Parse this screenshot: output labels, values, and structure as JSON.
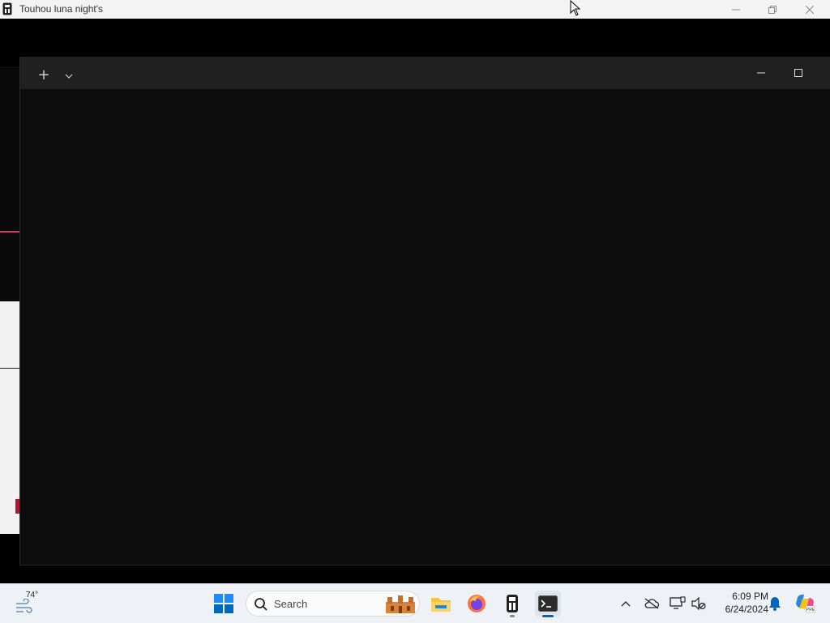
{
  "game_window": {
    "title": "Touhou luna night's"
  },
  "terminal": {
    "new_tab_label": "+"
  },
  "taskbar": {
    "weather": {
      "temp": "74°",
      "icon": "wind-icon"
    },
    "search": {
      "label": "Search"
    },
    "apps": [
      {
        "name": "file-explorer",
        "icon": "folder-icon"
      },
      {
        "name": "firefox",
        "icon": "firefox-icon"
      },
      {
        "name": "touhou-game",
        "icon": "game-icon"
      },
      {
        "name": "terminal",
        "icon": "terminal-icon"
      }
    ],
    "clock": {
      "time": "6:09 PM",
      "date": "6/24/2024"
    }
  },
  "colors": {
    "accent": "#0067c0",
    "terminal_bg": "#0c0c0c",
    "terminal_tabbar": "#202020",
    "taskbar_bg": "#eef1f5"
  }
}
